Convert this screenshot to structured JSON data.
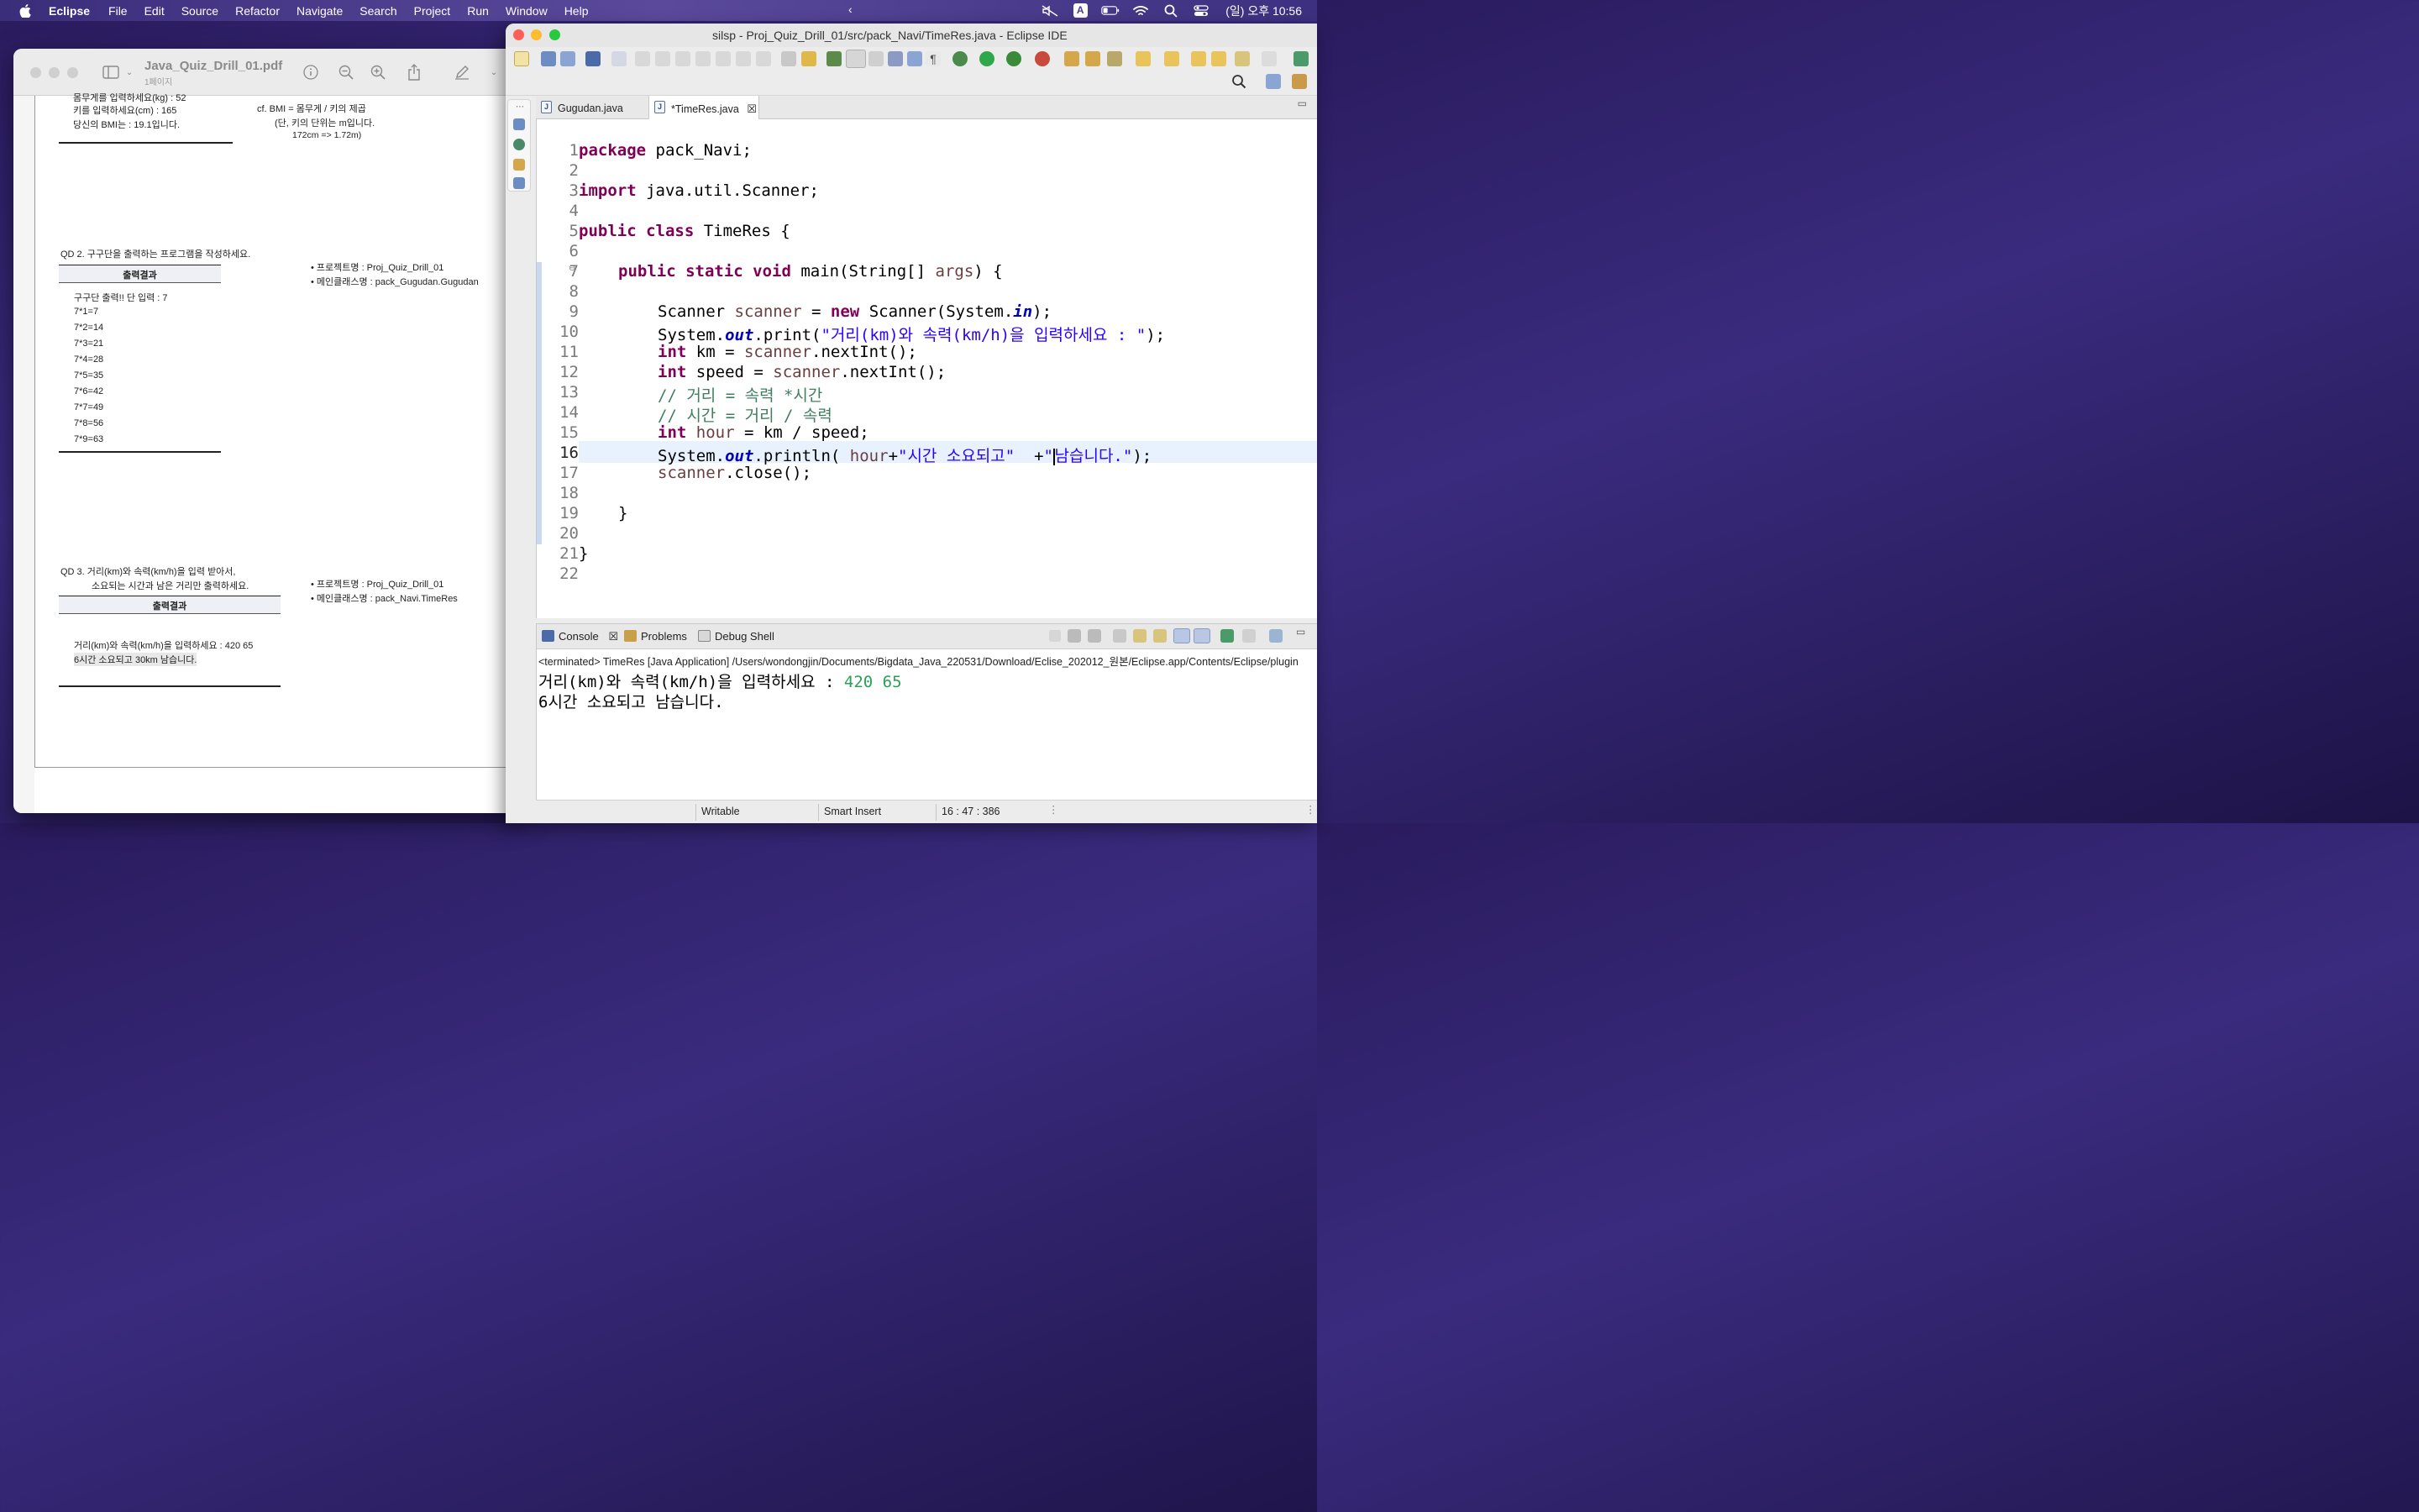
{
  "menubar": {
    "app_name": "Eclipse",
    "menus": [
      "File",
      "Edit",
      "Source",
      "Refactor",
      "Navigate",
      "Search",
      "Project",
      "Run",
      "Window",
      "Help"
    ],
    "input_source": "A",
    "clock": "(일) 오후 10:56"
  },
  "preview": {
    "title": "Java_Quiz_Drill_01.pdf",
    "subtitle": "1페이지",
    "doc": {
      "top_partial": "몸무게를 입력하세요(kg) : 52",
      "height_prompt": "키를 입력하세요(cm) : 165",
      "bmi_result": "당신의 BMI는 : 19.1입니다.",
      "bmi_note_1": "cf.   BMI  =  몸무게 / 키의 제곱",
      "bmi_note_2": "(단, 키의 단위는  m입니다.",
      "bmi_note_3": "172cm    =>  1.72m)",
      "qd2_title": "QD 2.  구구단을 출력하는 프로그램을 작성하세요.",
      "qd2_box_header": "출력결과",
      "qd2_project": "•  프로젝트명    :    Proj_Quiz_Drill_01",
      "qd2_mainclass": "•  메인클래스명  :  pack_Gugudan.Gugudan",
      "qd2_lines": [
        "구구단 출력!! 단 입력 : 7",
        "7*1=7",
        "7*2=14",
        "7*3=21",
        "7*4=28",
        "7*5=35",
        "7*6=42",
        "7*7=49",
        "7*8=56",
        "7*9=63"
      ],
      "qd3_title_1": "QD 3.  거리(km)와 속력(km/h)을  입력  받아서,",
      "qd3_title_2": "소요되는 시간과 남은 거리만  출력하세요.",
      "qd3_box_header": "출력결과",
      "qd3_project": "•  프로젝트명    :   Proj_Quiz_Drill_01",
      "qd3_mainclass": "•  메인클래스명 :  pack_Navi.TimeRes",
      "qd3_out_1": "거리(km)와 속력(km/h)을 입력하세요 : 420  65",
      "qd3_out_2": "6시간  소요되고  30km  남습니다."
    }
  },
  "eclipse": {
    "window_title": "silsp - Proj_Quiz_Drill_01/src/pack_Navi/TimeRes.java - Eclipse IDE",
    "tabs": [
      {
        "label": "Gugudan.java",
        "active": false
      },
      {
        "label": "*TimeRes.java",
        "active": true
      }
    ],
    "code_lines": [
      {
        "n": "1"
      },
      {
        "n": "2"
      },
      {
        "n": "3"
      },
      {
        "n": "4"
      },
      {
        "n": "5"
      },
      {
        "n": "6"
      },
      {
        "n": "7"
      },
      {
        "n": "8"
      },
      {
        "n": "9"
      },
      {
        "n": "10"
      },
      {
        "n": "11"
      },
      {
        "n": "12"
      },
      {
        "n": "13"
      },
      {
        "n": "14"
      },
      {
        "n": "15"
      },
      {
        "n": "16"
      },
      {
        "n": "17"
      },
      {
        "n": "18"
      },
      {
        "n": "19"
      },
      {
        "n": "20"
      },
      {
        "n": "21"
      },
      {
        "n": "22"
      }
    ],
    "code": {
      "l1_kw": "package",
      "l1_rest": " pack_Navi;",
      "l3_kw": "import",
      "l3_rest": " java.util.Scanner;",
      "l5_kw": "public class",
      "l5_rest": " TimeRes {",
      "l7_kw": "public static void",
      "l7_a": " main(String[] ",
      "l7_param": "args",
      "l7_b": ") {",
      "l9_a": "Scanner ",
      "l9_var": "scanner",
      "l9_b": " = ",
      "l9_kw": "new",
      "l9_c": " Scanner(System.",
      "l9_fld": "in",
      "l9_d": ");",
      "l10_a": "System.",
      "l10_fld": "out",
      "l10_b": ".print(",
      "l10_str": "\"거리(km)와 속력(km/h)을 입력하세요 : \"",
      "l10_c": ");",
      "l11_kw": "int",
      "l11_a": " km = ",
      "l11_var": "scanner",
      "l11_b": ".nextInt();",
      "l12_kw": "int",
      "l12_a": " speed = ",
      "l12_var": "scanner",
      "l12_b": ".nextInt();",
      "l13_cmt": "// 거리 = 속력 *시간",
      "l14_cmt": "// 시간 = 거리 / 속력",
      "l15_kw": "int",
      "l15_var": " hour",
      "l15_a": " = km / speed;",
      "l16_a": "System.",
      "l16_fld": "out",
      "l16_b": ".println( ",
      "l16_var": "hour",
      "l16_c": "+",
      "l16_str1": "\"시간 소요되고\"",
      "l16_d": "  +",
      "l16_str2a": "\"",
      "l16_str2b": "남습니다.\"",
      "l16_e": ");",
      "l17_var": "scanner",
      "l17_a": ".close();",
      "l19": "}",
      "l21": "}"
    },
    "console": {
      "tabs": [
        "Console",
        "Problems",
        "Debug Shell"
      ],
      "terminated": "<terminated> TimeRes [Java Application] /Users/wondongjin/Documents/Bigdata_Java_220531/Download/Eclise_202012_원본/Eclipse.app/Contents/Eclipse/plugin",
      "out_1_prompt": "거리(km)와 속력(km/h)을 입력하세요 : ",
      "out_1_input": "420 65",
      "out_2": "6시간 소요되고 남습니다."
    },
    "status": {
      "writable": "Writable",
      "insert_mode": "Smart Insert",
      "position": "16 : 47 : 386"
    }
  },
  "colors": {
    "keyword": "#7f0055",
    "string": "#2a00ff",
    "comment": "#3f7f5f",
    "field": "#0000c0",
    "console_input": "#2ca05a"
  }
}
